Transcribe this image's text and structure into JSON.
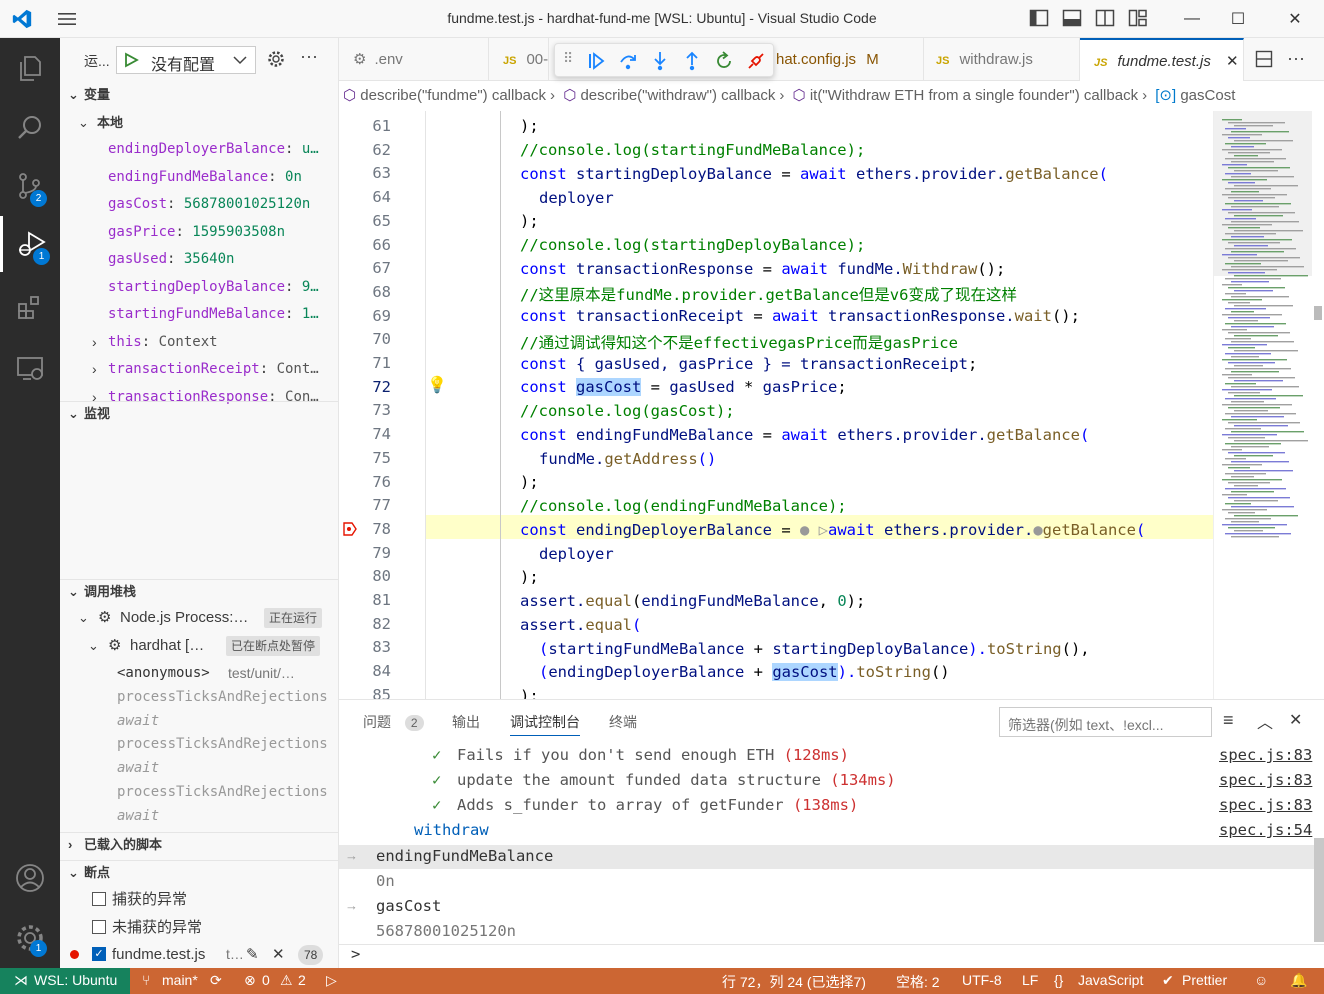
{
  "window": {
    "title": "fundme.test.js - hardhat-fund-me [WSL: Ubuntu] - Visual Studio Code",
    "minimize": "—",
    "maximize": "☐",
    "close": "✕"
  },
  "activity": {
    "scm_badge": "2",
    "debug_badge": "1",
    "settings_badge": "1"
  },
  "sidebar": {
    "run_label": "运...",
    "config_label": "没有配置",
    "variables_title": "变量",
    "local_title": "本地",
    "variables": [
      {
        "name": "endingDeployerBalance",
        "value": "u…"
      },
      {
        "name": "endingFundMeBalance",
        "value": "0n"
      },
      {
        "name": "gasCost",
        "value": "56878001025120n"
      },
      {
        "name": "gasPrice",
        "value": "1595903508n"
      },
      {
        "name": "gasUsed",
        "value": "35640n"
      },
      {
        "name": "startingDeployBalance",
        "value": "9…"
      },
      {
        "name": "startingFundMeBalance",
        "value": "1…"
      },
      {
        "name": "this",
        "value": "Context"
      },
      {
        "name": "transactionReceipt",
        "value": "Cont…"
      },
      {
        "name": "transactionResponse",
        "value": "Con…"
      }
    ],
    "watch_title": "监视",
    "callstack_title": "调用堆栈",
    "callstack": {
      "process_name": "Node.js Process:…",
      "process_status": "正在运行",
      "thread_name": "hardhat […",
      "thread_status": "已在断点处暂停",
      "frames": [
        {
          "name": "<anonymous>",
          "file": "test/unit/…"
        },
        {
          "name": "processTicksAndRejections",
          "file": ""
        },
        {
          "name": "await",
          "file": ""
        },
        {
          "name": "processTicksAndRejections",
          "file": ""
        },
        {
          "name": "await",
          "file": ""
        },
        {
          "name": "processTicksAndRejections",
          "file": ""
        },
        {
          "name": "await",
          "file": ""
        }
      ]
    },
    "loaded_scripts_title": "已载入的脚本",
    "breakpoints_title": "断点",
    "breakpoints": {
      "caught": "捕获的异常",
      "uncaught": "未捕获的异常",
      "file": "fundme.test.js",
      "file_extra": "t…",
      "line": "78"
    }
  },
  "tabs": [
    {
      "label": ".env",
      "icon": "gear-icon"
    },
    {
      "label": "00-",
      "icon": "js-icon"
    },
    {
      "label": "hat.config.js",
      "modified": "M"
    },
    {
      "label": "withdraw.js",
      "icon": "js-icon"
    },
    {
      "label": "fundme.test.js",
      "icon": "js-icon",
      "active": true
    }
  ],
  "breadcrumb": [
    "describe(\"fundme\") callback",
    "describe(\"withdraw\") callback",
    "it(\"Withdraw ETH from a single founder\") callback",
    "gasCost"
  ],
  "editor": {
    "current_line": "72",
    "paused_line": "78",
    "line_numbers": [
      "61",
      "62",
      "63",
      "64",
      "65",
      "66",
      "67",
      "68",
      "69",
      "70",
      "71",
      "72",
      "73",
      "74",
      "75",
      "76",
      "77",
      "78",
      "79",
      "80",
      "81",
      "82",
      "83",
      "84",
      "85"
    ],
    "lines": {
      "l61": ");",
      "l62": "//console.log(startingFundMeBalance);",
      "l63a": "const",
      "l63b": "startingDeployBalance",
      "l63c": " = ",
      "l63d": "await",
      "l63e": " ethers",
      "l63f": ".provider.",
      "l63g": "getBalance",
      "l63h": "(",
      "l64": "deployer",
      "l65": ");",
      "l66": "//console.log(startingDeployBalance);",
      "l67a": "const",
      "l67b": "transactionResponse",
      "l67c": " = ",
      "l67d": "await",
      "l67e": " fundMe.",
      "l67f": "Withdraw",
      "l67g": "();",
      "l68": "//这里原本是fundMe.provider.getBalance但是v6变成了现在这样",
      "l69a": "const",
      "l69b": "transactionReceipt",
      "l69c": " = ",
      "l69d": "await",
      "l69e": " transactionResponse.",
      "l69f": "wait",
      "l69g": "();",
      "l70": "//通过调试得知这个不是effectivegasPrice而是gasPrice",
      "l71a": "const",
      "l71b": " { gasUsed, gasPrice } = ",
      "l71c": "transactionReceipt",
      "l71d": ";",
      "l72a": "const",
      "l72b": "gasCost",
      "l72c": " = ",
      "l72d": "gasUsed",
      "l72e": " * ",
      "l72f": "gasPrice",
      "l72g": ";",
      "l73": "//console.log(gasCost);",
      "l74a": "const",
      "l74b": "endingFundMeBalance",
      "l74c": " = ",
      "l74d": "await",
      "l74e": " ethers",
      "l74f": ".provider.",
      "l74g": "getBalance",
      "l74h": "(",
      "l75a": "fundMe.",
      "l75b": "getAddress",
      "l75c": "()",
      "l76": ");",
      "l77": "//console.log(endingFundMeBalance);",
      "l78a": "const",
      "l78b": "endingDeployerBalance",
      "l78c": " = ",
      "l78d": "await",
      "l78e": " ethers",
      "l78f": ".provider.",
      "l78g": "getBalance",
      "l78h": "(",
      "l79": "deployer",
      "l80": ");",
      "l81a": "assert.",
      "l81b": "equal",
      "l81c": "(",
      "l81d": "endingFundMeBalance",
      "l81e": ", ",
      "l81f": "0",
      "l81g": ");",
      "l82a": "assert.",
      "l82b": "equal",
      "l82c": "(",
      "l83a": "(",
      "l83b": "startingFundMeBalance",
      "l83c": " + ",
      "l83d": "startingDeployBalance",
      "l83e": ").",
      "l83f": "toString",
      "l83g": "(),",
      "l84a": "(",
      "l84b": "endingDeployerBalance",
      "l84c": " + ",
      "l84d": "gasCost",
      "l84e": ").",
      "l84f": "toString",
      "l84g": "()",
      "l85": ");"
    }
  },
  "panel": {
    "tabs": [
      "问题",
      "输出",
      "调试控制台",
      "终端"
    ],
    "problems_count": "2",
    "filter_placeholder": "筛选器(例如 text、!excl...",
    "output": [
      {
        "text": "Fails if you don't send enough ETH",
        "time": "(128ms)",
        "spec": "spec.js:83"
      },
      {
        "text": "update the amount funded data structure",
        "time": "(134ms)",
        "spec": "spec.js:83"
      },
      {
        "text": "Adds s_funder to array of getFunder",
        "time": "(138ms)",
        "spec": "spec.js:83"
      }
    ],
    "suite": "withdraw",
    "suite_spec": "spec.js:54",
    "eval1": "endingFundMeBalance",
    "result1": "0n",
    "eval2": "gasCost",
    "result2": "56878001025120n",
    "prompt": ">"
  },
  "statusbar": {
    "remote": "WSL: Ubuntu",
    "branch": "main*",
    "errors": "0",
    "warnings": "2",
    "position": "行 72，列 24 (已选择7)",
    "spaces": "空格: 2",
    "encoding": "UTF-8",
    "eol": "LF",
    "language": "JavaScript",
    "formatter": "Prettier"
  },
  "colors": {
    "accent": "#005fb8",
    "statusbar": "#cc6633",
    "activitybar": "#2c2c2c",
    "current_line": "#ffffc9"
  }
}
